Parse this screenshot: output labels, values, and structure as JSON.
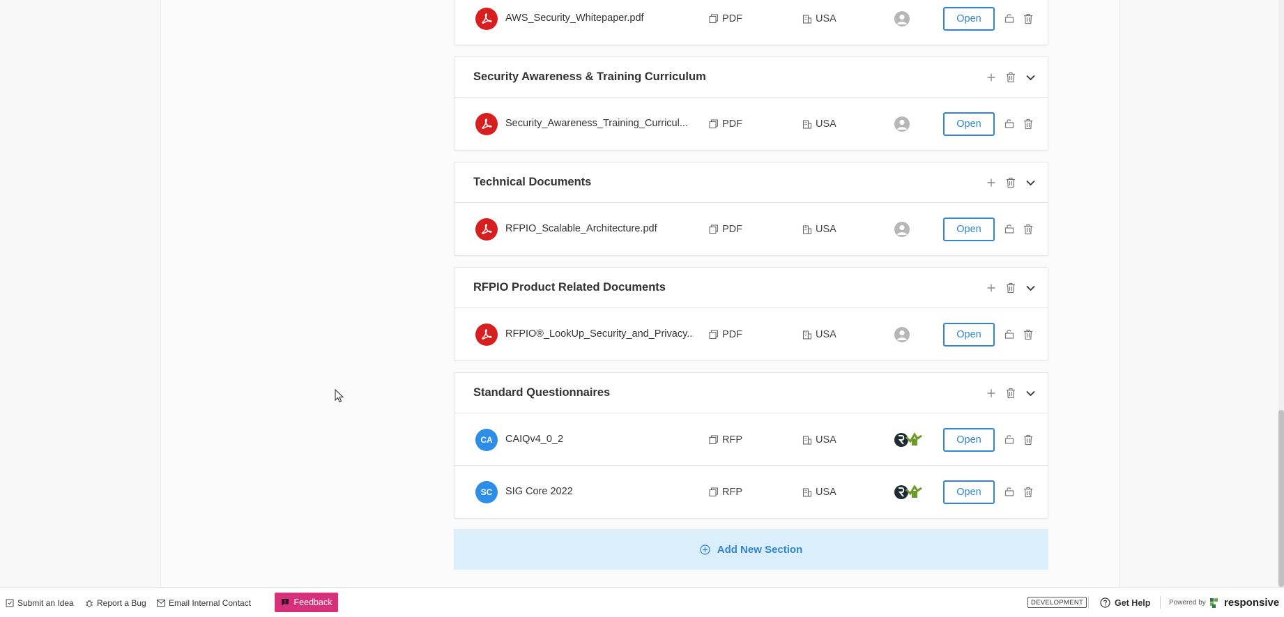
{
  "sections": [
    {
      "title": "",
      "documents": [
        {
          "name": "AWS_Security_Whitepaper.pdf",
          "badge": "pdf",
          "type": "PDF",
          "region": "USA",
          "owner": "default-avatar",
          "open_label": "Open"
        }
      ]
    },
    {
      "title": "Security Awareness & Training Curriculum",
      "documents": [
        {
          "name": "Security_Awareness_Training_Curricul...",
          "badge": "pdf",
          "type": "PDF",
          "region": "USA",
          "owner": "default-avatar",
          "open_label": "Open"
        }
      ]
    },
    {
      "title": "Technical Documents",
      "documents": [
        {
          "name": "RFPIO_Scalable_Architecture.pdf",
          "badge": "pdf",
          "type": "PDF",
          "region": "USA",
          "owner": "default-avatar",
          "open_label": "Open"
        }
      ]
    },
    {
      "title": "RFPIO Product Related Documents",
      "documents": [
        {
          "name": "RFPIO®_LookUp_Security_and_Privacy...",
          "badge": "pdf",
          "type": "PDF",
          "region": "USA",
          "owner": "default-avatar",
          "open_label": "Open"
        }
      ]
    },
    {
      "title": "Standard Questionnaires",
      "documents": [
        {
          "name": "CAIQv4_0_2",
          "badge": "CA",
          "type": "RFP",
          "region": "USA",
          "owner": "company-logo",
          "open_label": "Open"
        },
        {
          "name": "SIG Core 2022",
          "badge": "SC",
          "type": "RFP",
          "region": "USA",
          "owner": "company-logo",
          "open_label": "Open"
        }
      ]
    }
  ],
  "add_section_label": "Add New Section",
  "footer": {
    "submit_idea": "Submit an Idea",
    "report_bug": "Report a Bug",
    "email_contact": "Email Internal Contact",
    "feedback": "Feedback",
    "environment": "DEVELOPMENT",
    "get_help": "Get Help",
    "powered_by": "Powered by",
    "brand": "responsive"
  },
  "colors": {
    "accent": "#2f86d6",
    "pdf_red": "#d71f1f",
    "feedback_pink": "#d6317a",
    "add_section_bg": "#dbeefb",
    "initials_blue": "#2d8ee8"
  }
}
